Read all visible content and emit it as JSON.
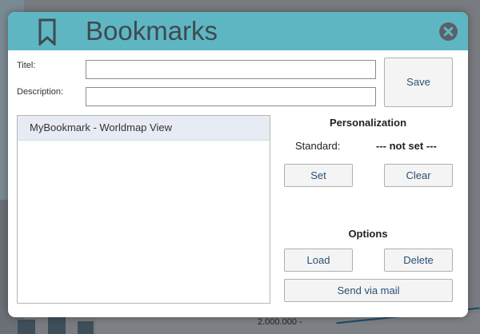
{
  "background": {
    "axis_label": "2.000.000 -"
  },
  "dialog": {
    "title": "Bookmarks",
    "icon": "bookmark-icon",
    "close_icon": "close-icon",
    "fields": {
      "title_label": "Titel:",
      "title_value": "",
      "description_label": "Description:",
      "description_value": ""
    },
    "save_label": "Save",
    "bookmarks": [
      {
        "label": "MyBookmark - Worldmap View",
        "selected": true
      }
    ],
    "personalization": {
      "heading": "Personalization",
      "standard_label": "Standard:",
      "standard_value": "--- not set ---",
      "set_label": "Set",
      "clear_label": "Clear"
    },
    "options": {
      "heading": "Options",
      "load_label": "Load",
      "delete_label": "Delete",
      "send_label": "Send via mail"
    }
  },
  "colors": {
    "header": "#5fb6c3",
    "title_text": "#3e4a52",
    "button_text": "#2a4f73",
    "selected_row": "#e7ebf3",
    "overlay": "#787c80"
  }
}
